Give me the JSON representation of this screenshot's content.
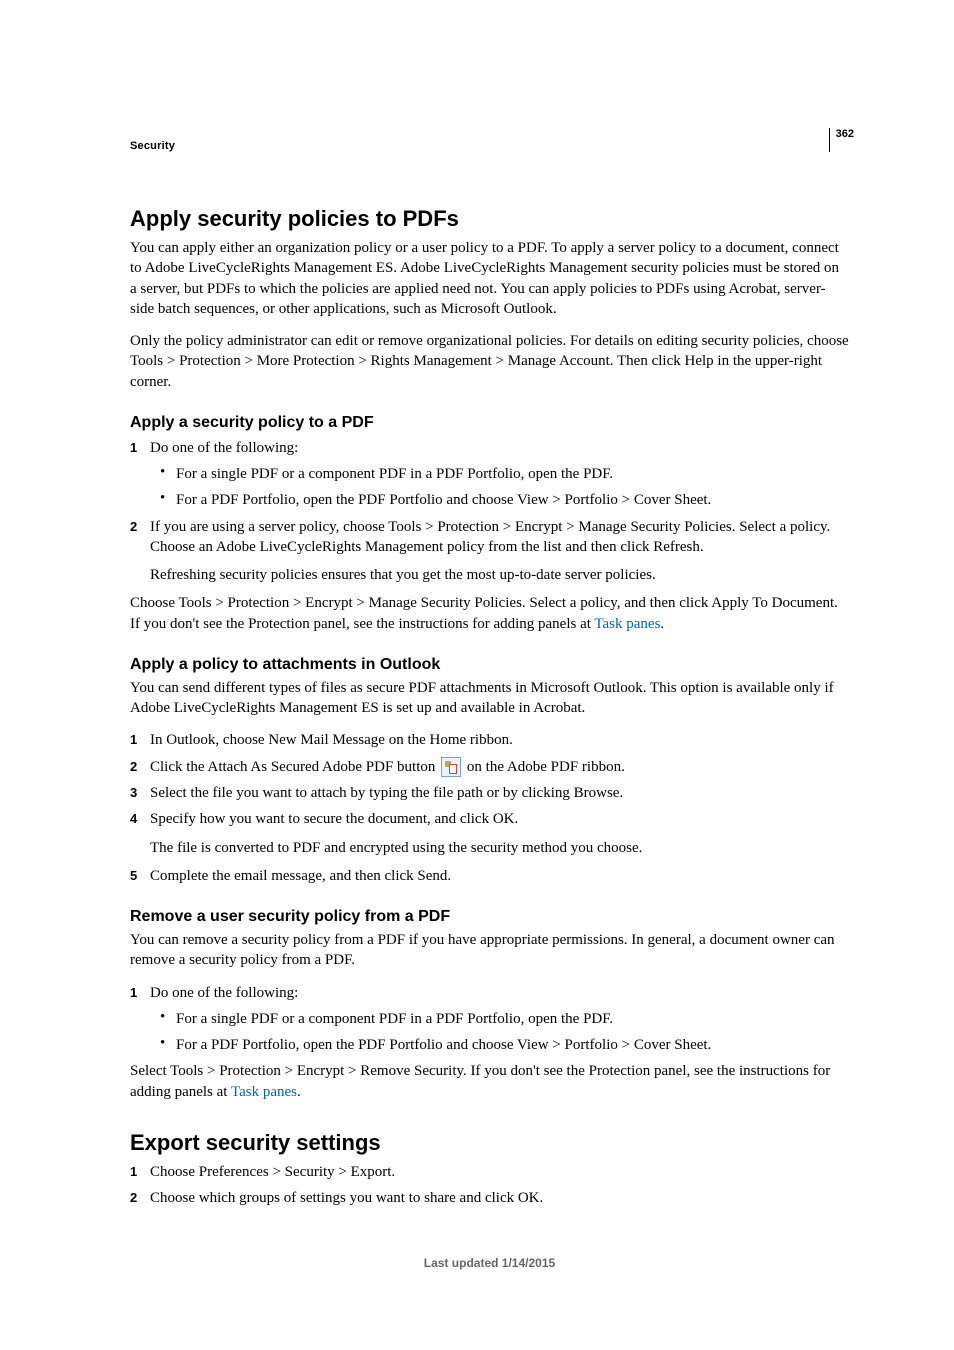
{
  "page_number": "362",
  "section_label": "Security",
  "h1_a": "Apply security policies to PDFs",
  "p1": "You can apply either an organization policy or a user policy to a PDF. To apply a server policy to a document, connect to Adobe LiveCycleRights Management ES. Adobe LiveCycleRights Management security policies must be stored on a server, but PDFs to which the policies are applied need not. You can apply policies to PDFs using Acrobat, server-side batch sequences, or other applications, such as Microsoft Outlook.",
  "p2": "Only the policy administrator can edit or remove organizational policies. For details on editing security policies, choose Tools > Protection > More Protection > Rights Management > Manage Account. Then click Help in the upper-right corner.",
  "h2_a": "Apply a security policy to a PDF",
  "a_step1": "Do one of the following:",
  "a_bullet1": "For a single PDF or a component PDF in a PDF Portfolio, open the PDF.",
  "a_bullet2": "For a PDF Portfolio, open the PDF Portfolio and choose View > Portfolio > Cover Sheet.",
  "a_step2": "If you are using a server policy, choose Tools > Protection > Encrypt > Manage Security Policies. Select a policy. Choose an Adobe LiveCycleRights Management policy from the list and then click Refresh.",
  "a_step2_note": "Refreshing security policies ensures that you get the most up-to-date server policies.",
  "p3_a": "Choose Tools > Protection > Encrypt > Manage Security Policies. Select a policy, and then click Apply To Document. If you don't see the Protection panel, see the instructions for adding panels at ",
  "p3_link": "Task panes",
  "p3_b": ".",
  "h2_b": "Apply a policy to attachments in Outlook",
  "p4": "You can send different types of files as secure PDF attachments in Microsoft Outlook. This option is available only if Adobe LiveCycleRights Management ES is set up and available in Acrobat.",
  "b_step1": "In Outlook, choose New Mail Message on the Home ribbon.",
  "b_step2_a": "Click the Attach As Secured Adobe PDF button ",
  "b_step2_b": " on the Adobe PDF ribbon.",
  "b_step3": "Select the file you want to attach by typing the file path or by clicking Browse.",
  "b_step4": "Specify how you want to secure the document, and click OK.",
  "b_step4_note": "The file is converted to PDF and encrypted using the security method you choose.",
  "b_step5": "Complete the email message, and then click Send.",
  "h2_c": "Remove a user security policy from a PDF",
  "p5": "You can remove a security policy from a PDF if you have appropriate permissions. In general, a document owner can remove a security policy from a PDF.",
  "c_step1": "Do one of the following:",
  "c_bullet1": "For a single PDF or a component PDF in a PDF Portfolio, open the PDF.",
  "c_bullet2": "For a PDF Portfolio, open the PDF Portfolio and choose View > Portfolio > Cover Sheet.",
  "p6_a": "Select Tools > Protection > Encrypt > Remove Security. If you don't see the Protection panel, see the instructions for adding panels at ",
  "p6_link": "Task panes",
  "p6_b": ".",
  "h1_b": "Export security settings",
  "d_step1": "Choose Preferences > Security > Export.",
  "d_step2": "Choose which groups of settings you want to share and click OK.",
  "footer": "Last updated 1/14/2015"
}
